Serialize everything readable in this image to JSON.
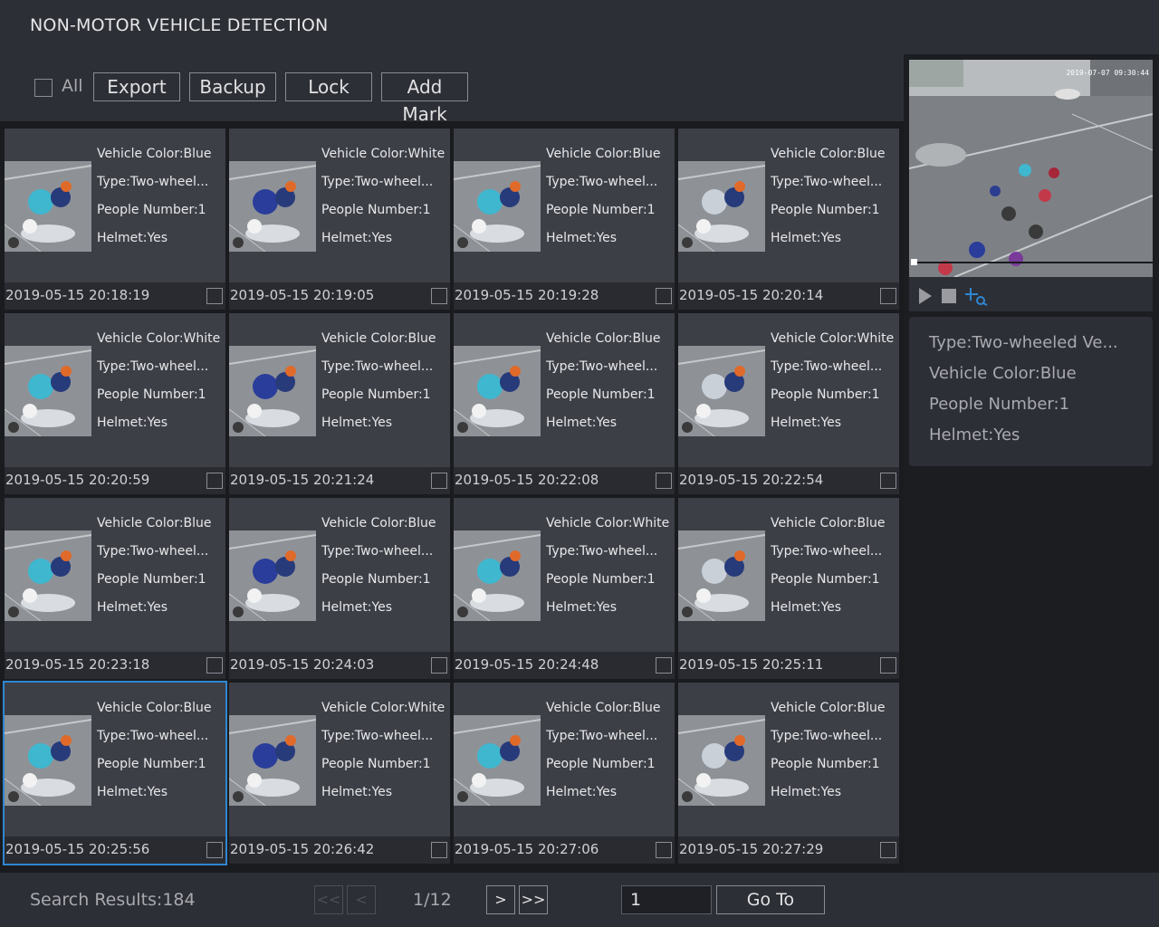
{
  "window": {
    "title": "NON-MOTOR VEHICLE DETECTION"
  },
  "toolbar": {
    "all_label": "All",
    "export_label": "Export",
    "backup_label": "Backup",
    "lock_label": "Lock",
    "add_mark_label": "Add Mark"
  },
  "records": [
    {
      "color": "Vehicle Color:Blue",
      "type": "Type:Two-wheel...",
      "people": "People Number:1",
      "helmet": "Helmet:Yes",
      "time": "2019-05-15 20:18:19"
    },
    {
      "color": "Vehicle Color:White",
      "type": "Type:Two-wheel...",
      "people": "People Number:1",
      "helmet": "Helmet:Yes",
      "time": "2019-05-15 20:19:05"
    },
    {
      "color": "Vehicle Color:Blue",
      "type": "Type:Two-wheel...",
      "people": "People Number:1",
      "helmet": "Helmet:Yes",
      "time": "2019-05-15 20:19:28"
    },
    {
      "color": "Vehicle Color:Blue",
      "type": "Type:Two-wheel...",
      "people": "People Number:1",
      "helmet": "Helmet:Yes",
      "time": "2019-05-15 20:20:14"
    },
    {
      "color": "Vehicle Color:White",
      "type": "Type:Two-wheel...",
      "people": "People Number:1",
      "helmet": "Helmet:Yes",
      "time": "2019-05-15 20:20:59"
    },
    {
      "color": "Vehicle Color:Blue",
      "type": "Type:Two-wheel...",
      "people": "People Number:1",
      "helmet": "Helmet:Yes",
      "time": "2019-05-15 20:21:24"
    },
    {
      "color": "Vehicle Color:Blue",
      "type": "Type:Two-wheel...",
      "people": "People Number:1",
      "helmet": "Helmet:Yes",
      "time": "2019-05-15 20:22:08"
    },
    {
      "color": "Vehicle Color:White",
      "type": "Type:Two-wheel...",
      "people": "People Number:1",
      "helmet": "Helmet:Yes",
      "time": "2019-05-15 20:22:54"
    },
    {
      "color": "Vehicle Color:Blue",
      "type": "Type:Two-wheel...",
      "people": "People Number:1",
      "helmet": "Helmet:Yes",
      "time": "2019-05-15 20:23:18"
    },
    {
      "color": "Vehicle Color:Blue",
      "type": "Type:Two-wheel...",
      "people": "People Number:1",
      "helmet": "Helmet:Yes",
      "time": "2019-05-15 20:24:03"
    },
    {
      "color": "Vehicle Color:White",
      "type": "Type:Two-wheel...",
      "people": "People Number:1",
      "helmet": "Helmet:Yes",
      "time": "2019-05-15 20:24:48"
    },
    {
      "color": "Vehicle Color:Blue",
      "type": "Type:Two-wheel...",
      "people": "People Number:1",
      "helmet": "Helmet:Yes",
      "time": "2019-05-15 20:25:11"
    },
    {
      "color": "Vehicle Color:Blue",
      "type": "Type:Two-wheel...",
      "people": "People Number:1",
      "helmet": "Helmet:Yes",
      "time": "2019-05-15 20:25:56"
    },
    {
      "color": "Vehicle Color:White",
      "type": "Type:Two-wheel...",
      "people": "People Number:1",
      "helmet": "Helmet:Yes",
      "time": "2019-05-15 20:26:42"
    },
    {
      "color": "Vehicle Color:Blue",
      "type": "Type:Two-wheel...",
      "people": "People Number:1",
      "helmet": "Helmet:Yes",
      "time": "2019-05-15 20:27:06"
    },
    {
      "color": "Vehicle Color:Blue",
      "type": "Type:Two-wheel...",
      "people": "People Number:1",
      "helmet": "Helmet:Yes",
      "time": "2019-05-15 20:27:29"
    }
  ],
  "selected_index": 12,
  "preview": {
    "timestamp": "2019-07-07 09:30:44",
    "controls": [
      "play-icon",
      "stop-icon",
      "crop-icon"
    ],
    "accent": "#2f86d1"
  },
  "detail": {
    "type": "Type:Two-wheeled Ve...",
    "color": "Vehicle Color:Blue",
    "people": "People Number:1",
    "helmet": "Helmet:Yes"
  },
  "footer": {
    "results": "Search Results:184",
    "first": "<<",
    "prev": "<",
    "page": "1/12",
    "next": ">",
    "last": ">>",
    "page_input": "1",
    "goto_label": "Go To"
  }
}
